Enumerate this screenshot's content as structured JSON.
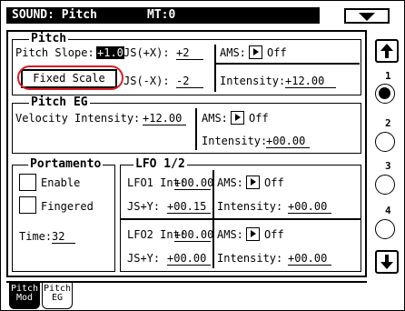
{
  "title": {
    "left": "SOUND: Pitch",
    "right": "MT:0"
  },
  "page_scroller": {
    "up_icon": "up-arrow-icon",
    "down_icon": "down-arrow-icon",
    "pages": [
      "1",
      "2",
      "3",
      "4"
    ],
    "selected_page": "1"
  },
  "pitch": {
    "section_label": "Pitch",
    "slope_label": "Pitch Slope:",
    "slope_value": "+1.0",
    "js_plus_label": "JS(+X):",
    "js_plus_value": "+2",
    "js_minus_label": "JS(-X):",
    "js_minus_value": "-2",
    "fixed_scale_label": "Fixed Scale",
    "ams_label": "AMS:",
    "ams_value": "Off",
    "intensity_label": "Intensity:",
    "intensity_value": "+12.00"
  },
  "pitch_eg": {
    "section_label": "Pitch EG",
    "velocity_label": "Velocity Intensity:",
    "velocity_value": "+12.00",
    "ams_label": "AMS:",
    "ams_value": "Off",
    "intensity_label": "Intensity:",
    "intensity_value": "+00.00"
  },
  "portamento": {
    "section_label": "Portamento",
    "enable_label": "Enable",
    "fingered_label": "Fingered",
    "time_label": "Time:",
    "time_value": "32"
  },
  "lfo": {
    "section_label": "LFO 1/2",
    "lfo1_label": "LFO1 Int:",
    "lfo1_value": "+00.00",
    "lfo1_ams_label": "AMS:",
    "lfo1_ams_value": "Off",
    "lfo1_js_label": "JS+Y:",
    "lfo1_js_value": "+00.15",
    "lfo1_int_label": "Intensity:",
    "lfo1_int_value": "+00.00",
    "lfo2_label": "LFO2 Int:",
    "lfo2_value": "+00.00",
    "lfo2_ams_label": "AMS:",
    "lfo2_ams_value": "Off",
    "lfo2_js_label": "JS+Y:",
    "lfo2_js_value": "+00.00",
    "lfo2_int_label": "Intensity:",
    "lfo2_int_value": "+00.00"
  },
  "tabs": [
    {
      "line1": "Pitch",
      "line2": "Mod",
      "active": true
    },
    {
      "line1": "Pitch",
      "line2": "EG",
      "active": false
    }
  ],
  "colors": {
    "highlight_ring": "#d91d25",
    "ink": "#000000",
    "background": "#ffffff"
  }
}
